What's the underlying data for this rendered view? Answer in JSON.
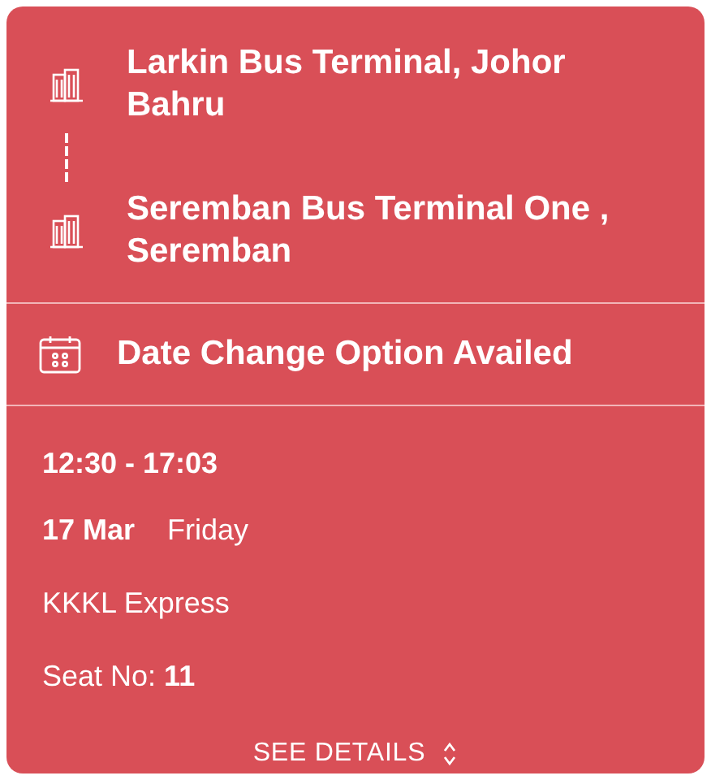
{
  "route": {
    "stops": [
      {
        "name": "Larkin Bus Terminal, Johor Bahru"
      },
      {
        "name": "Seremban Bus Terminal One , Seremban"
      }
    ]
  },
  "notice": {
    "text": "Date Change Option Availed"
  },
  "trip": {
    "time": "12:30 - 17:03",
    "date": "17 Mar",
    "weekday": "Friday",
    "operator": "KKKL Express",
    "seat": "Seat No: **11**"
  },
  "details_button": {
    "label": "SEE DETAILS"
  }
}
